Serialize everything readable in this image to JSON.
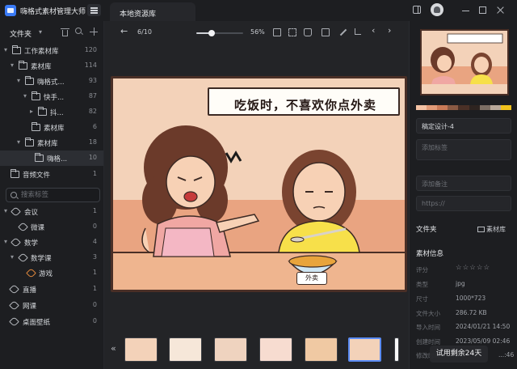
{
  "app": {
    "title": "嗨格式素材管理大师",
    "tab_label": "本地资源库"
  },
  "sidebar": {
    "header": "文件夹",
    "tree": [
      {
        "label": "工作素材库",
        "count": "120"
      },
      {
        "label": "素材库",
        "count": "114"
      },
      {
        "label": "嗨格式...",
        "count": "93"
      },
      {
        "label": "快手...",
        "count": "87"
      },
      {
        "label": "抖...",
        "count": "82"
      },
      {
        "label": "素材库",
        "count": "6"
      },
      {
        "label": "素材库",
        "count": "18"
      },
      {
        "label": "嗨格...",
        "count": "10"
      },
      {
        "label": "音频文件",
        "count": "1"
      }
    ],
    "search_placeholder": "搜索标签",
    "tags": [
      {
        "label": "会议",
        "count": "1"
      },
      {
        "label": "微课",
        "count": "0"
      },
      {
        "label": "数学",
        "count": "4"
      },
      {
        "label": "数学课",
        "count": "3"
      },
      {
        "label": "游戏",
        "count": "1"
      },
      {
        "label": "直播",
        "count": "1"
      },
      {
        "label": "网课",
        "count": "0"
      },
      {
        "label": "桌面壁纸",
        "count": "0"
      }
    ]
  },
  "viewer": {
    "page_indicator": "6/10",
    "zoom_percent": "56%",
    "zoom_level": 0.32,
    "image_caption": "吃饭时，不喜欢你点外卖",
    "bowl_text": "外卖",
    "thumbnail_count": 6,
    "active_thumbnail": 6
  },
  "details": {
    "name": "稿定设计-4",
    "tags_placeholder": "添加标签",
    "notes_placeholder": "添加备注",
    "url_placeholder": "https://",
    "folder_label": "文件夹",
    "folder_value": "素材库",
    "info_title": "素材信息",
    "rating_label": "评分",
    "rating_value": 0,
    "type_label": "类型",
    "type_value": "jpg",
    "size_label": "尺寸",
    "size_value": "1000*723",
    "filesize_label": "文件大小",
    "filesize_value": "286.72 KB",
    "import_label": "导入时间",
    "import_value": "2024/01/21 14:50",
    "created_label": "创建时间",
    "created_value": "2023/05/09 02:46",
    "modified_label": "修改时间",
    "modified_value": "...:46",
    "palette": [
      "#f4c2a4",
      "#e29b78",
      "#c97a57",
      "#8a5a43",
      "#4a3026",
      "#2e2420",
      "#7d6f64",
      "#b9a99a",
      "#f0c21d"
    ]
  },
  "trial_badge": "试用剩余24天"
}
